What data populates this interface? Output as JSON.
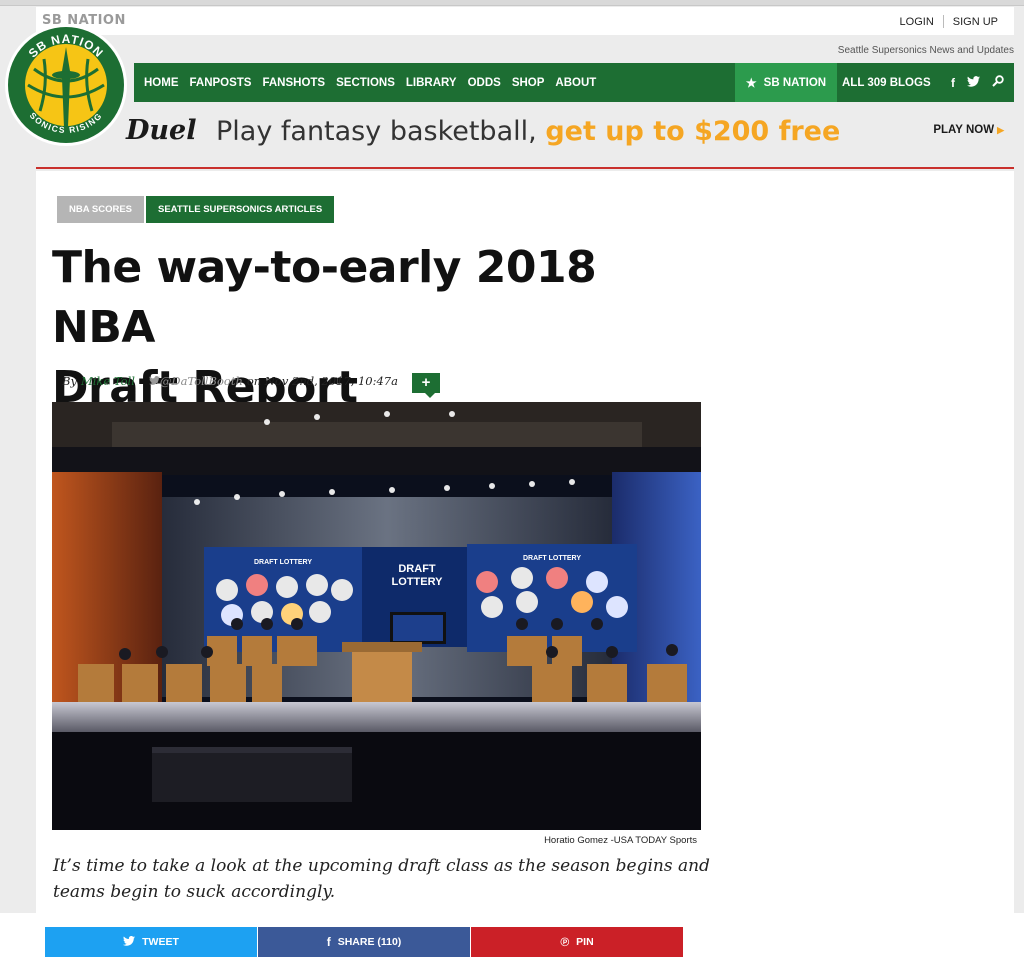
{
  "site": {
    "network_logo_text": "SB NATION",
    "logo_text": "SB NATION",
    "logo_ring_text": "SONICS RISING",
    "tagline": "Seattle Supersonics News and Updates"
  },
  "auth": {
    "login": "LOGIN",
    "signup": "SIGN UP"
  },
  "nav": {
    "items": [
      "HOME",
      "FANPOSTS",
      "FANSHOTS",
      "SECTIONS",
      "LIBRARY",
      "ODDS",
      "SHOP",
      "ABOUT"
    ],
    "sbnation": "SB NATION",
    "all_blogs": "ALL 309 BLOGS",
    "icons": [
      "facebook-icon",
      "twitter-icon",
      "search-icon"
    ]
  },
  "ad": {
    "brand": "Duel",
    "text_plain": "Play fantasy basketball,",
    "text_highlight": "get up to $200 free",
    "cta": "PLAY NOW",
    "highlight_color": "#f5a623"
  },
  "article": {
    "tags": [
      "NBA SCORES",
      "SEATTLE SUPERSONICS ARTICLES"
    ],
    "headline_line1": "The way-to-early 2018 NBA",
    "headline_line2": "Draft Report",
    "by": "By",
    "author": "Mike Toll",
    "twitter_handle": "@DaTollBooth",
    "date": "on Nov 2nd, 2017, 10:47a",
    "plus": "+",
    "photo_credit": "Horatio Gomez -USA TODAY Sports",
    "dek": "It’s time to take a look at the upcoming draft class as the season begins and teams begin to suck accordingly."
  },
  "photo_signage": {
    "banner": "DRAFT LOTTERY",
    "center_line1": "DRAFT",
    "center_line2": "LOTTERY"
  },
  "share": {
    "tweet": "TWEET",
    "facebook": "SHARE (110)",
    "pin": "PIN"
  },
  "colors": {
    "brand_green": "#1d6e33",
    "sbnation_green": "#2c9b4d",
    "twitter_blue": "#1da1f2",
    "facebook_blue": "#3b5998",
    "pinterest_red": "#cb2027",
    "logo_yellow": "#f6c515"
  }
}
